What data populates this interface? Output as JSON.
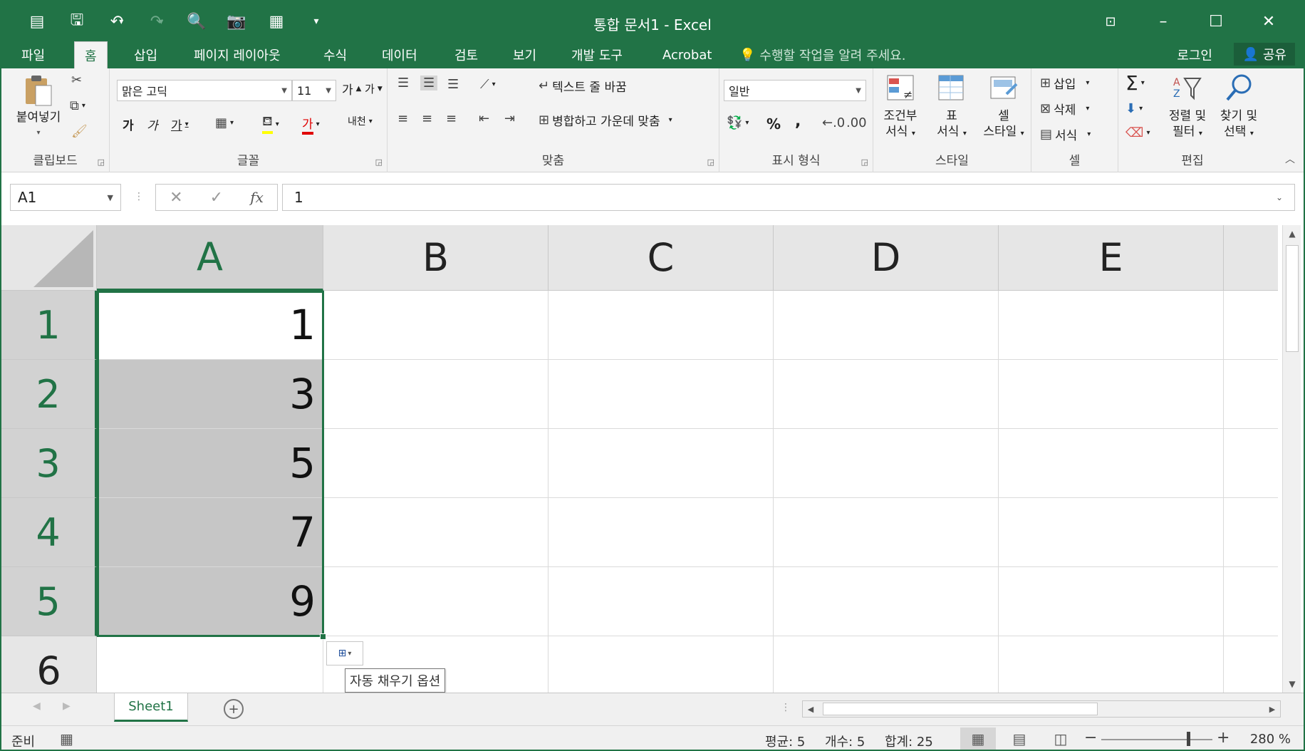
{
  "window": {
    "title": "통합 문서1 - Excel",
    "icons": [
      "customize-qat-icon",
      "save-icon",
      "undo-icon",
      "redo-icon",
      "print-preview-icon",
      "camera-icon",
      "form-icon",
      "qat-dropdown-icon"
    ],
    "ribbon_display_icon": "ribbon-display-icon",
    "minimize": "–",
    "maximize": "☐",
    "close": "✕"
  },
  "tabs": [
    {
      "label": "파일"
    },
    {
      "label": "홈"
    },
    {
      "label": "삽입"
    },
    {
      "label": "페이지 레이아웃"
    },
    {
      "label": "수식"
    },
    {
      "label": "데이터"
    },
    {
      "label": "검토"
    },
    {
      "label": "보기"
    },
    {
      "label": "개발 도구"
    },
    {
      "label": "Acrobat"
    }
  ],
  "tell_me": "수행할 작업을 알려 주세요.",
  "login": "로그인",
  "share": "공유",
  "ribbon": {
    "clipboard": {
      "label": "클립보드",
      "paste": "붙여넣기"
    },
    "font": {
      "label": "글꼴",
      "name": "맑은 고딕",
      "size": "11",
      "bold": "가",
      "italic": "가",
      "underline": "가",
      "grow": "가",
      "shrink": "가",
      "fill_color_letter": "가",
      "phonetic": "내천"
    },
    "alignment": {
      "label": "맞춤",
      "wrap": "텍스트 줄 바꿈",
      "merge": "병합하고 가운데 맞춤"
    },
    "number": {
      "label": "표시 형식",
      "format": "일반",
      "percent": "%",
      "comma": ","
    },
    "styles": {
      "label": "스타일",
      "conditional_1": "조건부",
      "conditional_2": "서식",
      "table_1": "표",
      "table_2": "서식",
      "cell_1": "셀",
      "cell_2": "스타일"
    },
    "cells": {
      "label": "셀",
      "insert": "삽입",
      "delete": "삭제",
      "format": "서식"
    },
    "editing": {
      "label": "편집",
      "sort_1": "정렬 및",
      "sort_2": "필터",
      "find_1": "찾기 및",
      "find_2": "선택"
    }
  },
  "formula_bar": {
    "name_box": "A1",
    "value": "1",
    "cancel": "✕",
    "enter": "✓",
    "fx": "fx"
  },
  "grid": {
    "columns": [
      "A",
      "B",
      "C",
      "D",
      "E"
    ],
    "rows": [
      "1",
      "2",
      "3",
      "4",
      "5",
      "6"
    ],
    "cells_A": [
      "1",
      "3",
      "5",
      "7",
      "9",
      ""
    ]
  },
  "autofill_tooltip": "자동 채우기 옵션",
  "sheet_tab": "Sheet1",
  "add_sheet": "+",
  "status": {
    "ready": "준비",
    "average": "평균: 5",
    "count": "개수: 5",
    "sum": "합계: 25",
    "zoom": "280 %"
  }
}
